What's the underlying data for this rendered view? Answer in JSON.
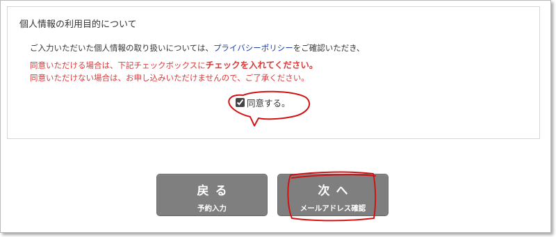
{
  "privacy": {
    "title": "個人情報の利用目的について",
    "line1_prefix": "ご入力いただいた個人情報の取り扱いについては、",
    "policy_link": "プライバシーポリシー",
    "line1_suffix": "をご確認いただき、",
    "line2_prefix": "同意いただける場合は、下記チェックボックスに",
    "line2_emphasis": "チェックを入れてください。",
    "line3": "同意いただけない場合は、お申し込みいただけませんので、ご了承ください。",
    "agree_label": "同意する。",
    "agree_checked": true
  },
  "buttons": {
    "back": {
      "label": "戻る",
      "sub": "予約入力"
    },
    "next": {
      "label": "次へ",
      "sub": "メールアドレス確認"
    }
  },
  "colors": {
    "notice_red": "#d93a3a",
    "link_blue": "#1b3fa3",
    "button_gray": "#7f7f7f",
    "annotation_red": "#d21212"
  },
  "icons": {
    "checkbox": "checkbox-checked-icon"
  }
}
